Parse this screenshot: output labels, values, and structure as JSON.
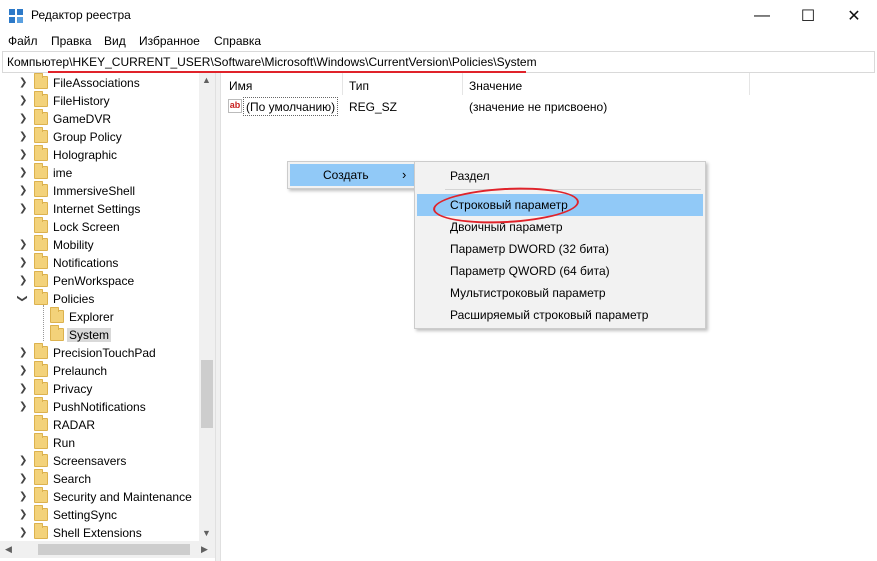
{
  "window": {
    "title": "Редактор реестра",
    "minimize": "—",
    "maximize": "☐",
    "close": "✕"
  },
  "menu": [
    "Файл",
    "Правка",
    "Вид",
    "Избранное",
    "Справка"
  ],
  "address": "Компьютер\\HKEY_CURRENT_USER\\Software\\Microsoft\\Windows\\CurrentVersion\\Policies\\System",
  "tree": [
    "FileAssociations",
    "FileHistory",
    "GameDVR",
    "Group Policy",
    "Holographic",
    "ime",
    "ImmersiveShell",
    "Internet Settings",
    "Lock Screen",
    "Mobility",
    "Notifications",
    "PenWorkspace",
    "Policies",
    "Explorer",
    "System",
    "PrecisionTouchPad",
    "Prelaunch",
    "Privacy",
    "PushNotifications",
    "RADAR",
    "Run",
    "Screensavers",
    "Search",
    "Security and Maintenance",
    "SettingSync",
    "Shell Extensions"
  ],
  "list": {
    "columns": [
      "Имя",
      "Тип",
      "Значение"
    ],
    "rows": [
      {
        "name": "(По умолчанию)",
        "type": "REG_SZ",
        "value": "(значение не присвоено)",
        "icon": "string-value-icon"
      }
    ]
  },
  "context_menu": {
    "create_label": "Создать",
    "arrow": "›"
  },
  "submenu": [
    "Раздел",
    "Строковый параметр",
    "Двоичный параметр",
    "Параметр DWORD (32 бита)",
    "Параметр QWORD (64 бита)",
    "Мультистроковый параметр",
    "Расширяемый строковый параметр"
  ],
  "submenu_highlighted": "Строковый параметр",
  "colors": {
    "annotation_red": "#e0232a",
    "menu_highlight": "#91c9f7",
    "folder": "#f3d27a"
  }
}
